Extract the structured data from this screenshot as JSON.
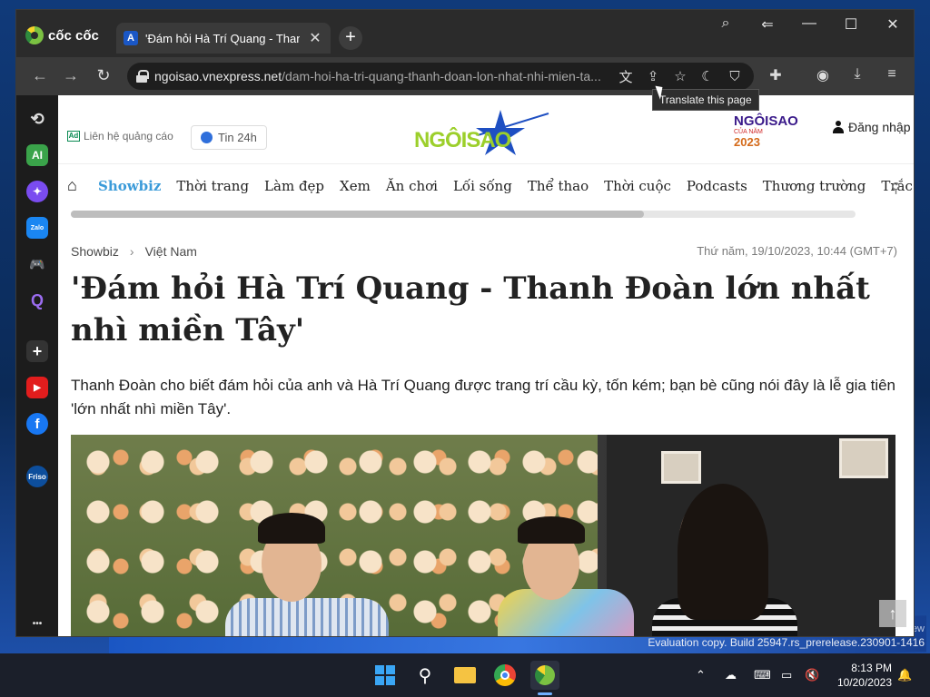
{
  "browser": {
    "brand": "cốc cốc",
    "tab_title": "'Đám hỏi Hà Trí Quang - Thanh Đ",
    "tab_favicon": "A",
    "url_host": "ngoisao.vnexpress.net",
    "url_path": "/dam-hoi-ha-tri-quang-thanh-doan-lon-nhat-nhi-mien-ta...",
    "tooltip": "Translate this page"
  },
  "sidebar": {
    "items": [
      {
        "icon": "history-icon",
        "glyph": "⟲"
      },
      {
        "icon": "ai-icon",
        "glyph": "AI"
      },
      {
        "icon": "messenger-icon",
        "glyph": "✦"
      },
      {
        "icon": "zalo-icon",
        "glyph": "Zalo"
      },
      {
        "icon": "game-icon",
        "glyph": "🎮"
      },
      {
        "icon": "q-icon",
        "glyph": "Q"
      },
      {
        "icon": "add-icon",
        "glyph": "+"
      },
      {
        "icon": "youtube-icon",
        "glyph": "▶"
      },
      {
        "icon": "facebook-icon",
        "glyph": "f"
      },
      {
        "icon": "friso-icon",
        "glyph": "Friso"
      },
      {
        "icon": "more-icon",
        "glyph": "•••"
      }
    ]
  },
  "site": {
    "ad_label": "Liên hệ quảng cáo",
    "ad_icon": "Ad",
    "tin24": "Tin 24h",
    "logo": "NGÔISAO",
    "logo2": "NGÔISAO",
    "logo2_sub": "CỦA NĂM",
    "logo2_year": "2023",
    "login": "Đăng nhập"
  },
  "nav": {
    "categories": [
      {
        "label": "Showbiz",
        "active": true
      },
      {
        "label": "Thời trang",
        "active": false
      },
      {
        "label": "Làm đẹp",
        "active": false
      },
      {
        "label": "Xem",
        "active": false
      },
      {
        "label": "Ăn chơi",
        "active": false
      },
      {
        "label": "Lối sống",
        "active": false
      },
      {
        "label": "Thể thao",
        "active": false
      },
      {
        "label": "Thời cuộc",
        "active": false
      },
      {
        "label": "Podcasts",
        "active": false
      },
      {
        "label": "Thương trường",
        "active": false
      },
      {
        "label": "Trắc n",
        "active": false
      }
    ],
    "scroll_fraction": 0.73
  },
  "article": {
    "breadcrumb": [
      "Showbiz",
      "Việt Nam"
    ],
    "date": "Thứ năm, 19/10/2023, 10:44 (GMT+7)",
    "headline": "'Đám hỏi Hà Trí Quang - Thanh Đoàn lớn nhất nhì miền Tây'",
    "lead": "Thanh Đoàn cho biết đám hỏi của anh và Hà Trí Quang được trang trí cầu kỳ, tốn kém; bạn bè cũng nói đây là lễ gia tiên 'lớn nhất nhì miền Tây'."
  },
  "desktop": {
    "eval_text": "Evaluation copy. Build 25947.rs_prerelease.230901-1416",
    "eval_new": "ew",
    "time": "8:13 PM",
    "date": "10/20/2023"
  },
  "colors": {
    "accent": "#3b9bd9",
    "logo_green": "#9ccf2b"
  }
}
